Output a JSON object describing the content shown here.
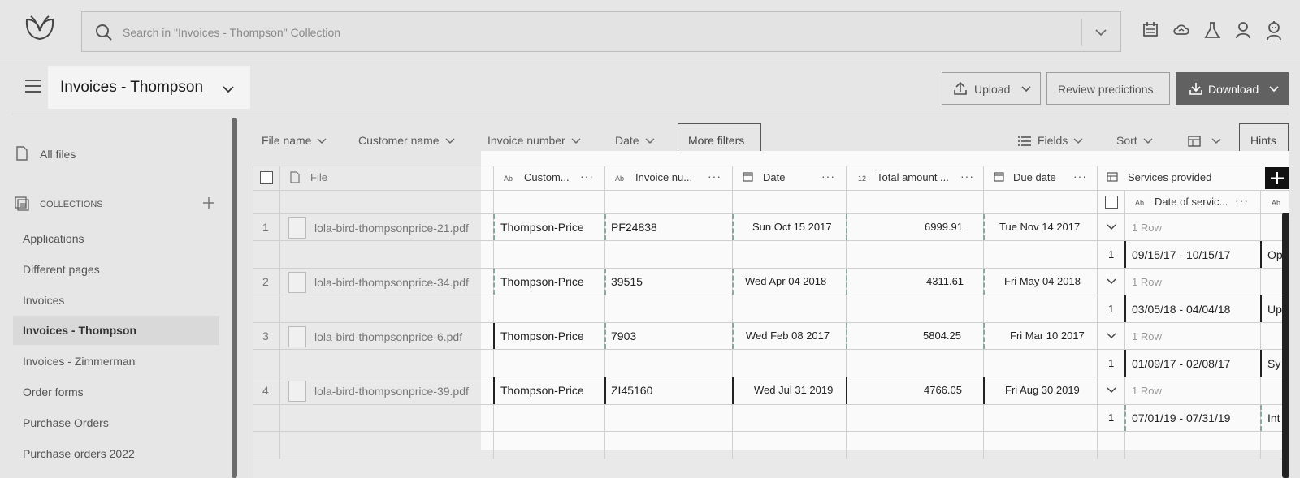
{
  "search": {
    "placeholder": "Search in \"Invoices - Thompson\" Collection"
  },
  "top_icons": [
    "calendar-icon",
    "cloud-icon",
    "flask-icon",
    "user-icon",
    "robot-icon"
  ],
  "header": {
    "title": "Invoices - Thompson",
    "upload_label": "Upload",
    "review_label": "Review predictions",
    "download_label": "Download"
  },
  "sidebar": {
    "all_files": "All files",
    "collections_label": "COLLECTIONS",
    "items": [
      {
        "label": "Applications"
      },
      {
        "label": "Different pages"
      },
      {
        "label": "Invoices"
      },
      {
        "label": "Invoices - Thompson",
        "active": true
      },
      {
        "label": "Invoices - Zimmerman"
      },
      {
        "label": "Order forms"
      },
      {
        "label": "Purchase Orders"
      },
      {
        "label": "Purchase orders 2022"
      }
    ]
  },
  "filters": {
    "file_name": "File name",
    "customer_name": "Customer name",
    "invoice_number": "Invoice number",
    "date": "Date",
    "more_filters": "More filters",
    "fields": "Fields",
    "sort": "Sort",
    "hints": "Hints"
  },
  "table": {
    "headers": {
      "file": "File",
      "customer": "Custom...",
      "invoice": "Invoice nu...",
      "date": "Date",
      "total": "Total amount ...",
      "due": "Due date",
      "services": "Services provided",
      "date_of_service": "Date of servic...",
      "ab": "Ab",
      "num12": "12"
    },
    "rows": [
      {
        "num": "1",
        "file": "lola-bird-thompsonprice-21.pdf",
        "customer": "Thompson-Price",
        "invoice": "PF24838",
        "date": "Sun Oct 15 2017",
        "total": "6999.91",
        "due": "Tue Nov 14 2017",
        "rows_label": "1 Row",
        "sub_num": "1",
        "service_date": "09/15/17 - 10/15/17",
        "service_next": "Op"
      },
      {
        "num": "2",
        "file": "lola-bird-thompsonprice-34.pdf",
        "customer": "Thompson-Price",
        "invoice": "39515",
        "date": "Wed Apr 04 2018",
        "total": "4311.61",
        "due": "Fri May 04 2018",
        "rows_label": "1 Row",
        "sub_num": "1",
        "service_date": "03/05/18 - 04/04/18",
        "service_next": "Up"
      },
      {
        "num": "3",
        "file": "lola-bird-thompsonprice-6.pdf",
        "customer": "Thompson-Price",
        "invoice": "7903",
        "date": "Wed Feb 08 2017",
        "total": "5804.25",
        "due": "Fri Mar 10 2017",
        "rows_label": "1 Row",
        "sub_num": "1",
        "service_date": "01/09/17 - 02/08/17",
        "service_next": "Sy"
      },
      {
        "num": "4",
        "file": "lola-bird-thompsonprice-39.pdf",
        "customer": "Thompson-Price",
        "invoice": "ZI45160",
        "date": "Wed Jul 31 2019",
        "total": "4766.05",
        "due": "Fri Aug 30 2019",
        "rows_label": "1 Row",
        "sub_num": "1",
        "service_date": "07/01/19 - 07/31/19",
        "service_next": "Int"
      }
    ]
  }
}
